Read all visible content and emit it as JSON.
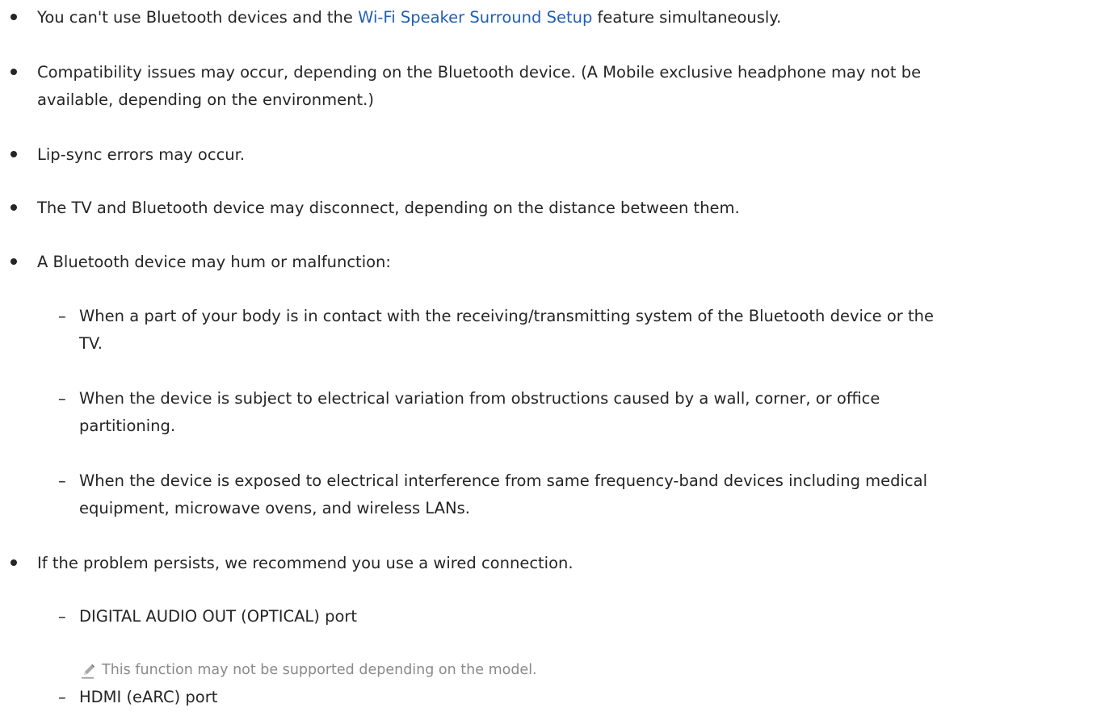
{
  "items": [
    {
      "text_before": "You can't use Bluetooth devices and the ",
      "link": "Wi-Fi Speaker Surround Setup",
      "text_after": " feature simultaneously."
    },
    {
      "line1": "Compatibility issues may occur, depending on the Bluetooth device. (A Mobile exclusive headphone may not be",
      "line2": "available, depending on the environment.)"
    },
    {
      "text": "Lip-sync errors may occur."
    },
    {
      "text": "The TV and Bluetooth device may disconnect, depending on the distance between them."
    },
    {
      "text": "A Bluetooth device may hum or malfunction:",
      "sub": [
        {
          "line1": "When a part of your body is in contact with the receiving/transmitting system of the Bluetooth device or the",
          "line2": "TV."
        },
        {
          "line1": "When the device is subject to electrical variation from obstructions caused by a wall, corner, or office",
          "line2": "partitioning."
        },
        {
          "line1": "When the device is exposed to electrical interference from same frequency-band devices including medical",
          "line2": "equipment, microwave ovens, and wireless LANs."
        }
      ]
    },
    {
      "text": "If the problem persists, we recommend you use a wired connection.",
      "sub": [
        {
          "text": "DIGITAL AUDIO OUT (OPTICAL) port",
          "note": "This function may not be supported depending on the model."
        },
        {
          "text": "HDMI (eARC) port"
        }
      ]
    }
  ],
  "symbols": {
    "dash": "–"
  },
  "icons": {
    "note": "pencil-note-icon"
  },
  "colors": {
    "text": "#252525",
    "link": "#1f5fb4",
    "note": "#8a8a8a"
  }
}
